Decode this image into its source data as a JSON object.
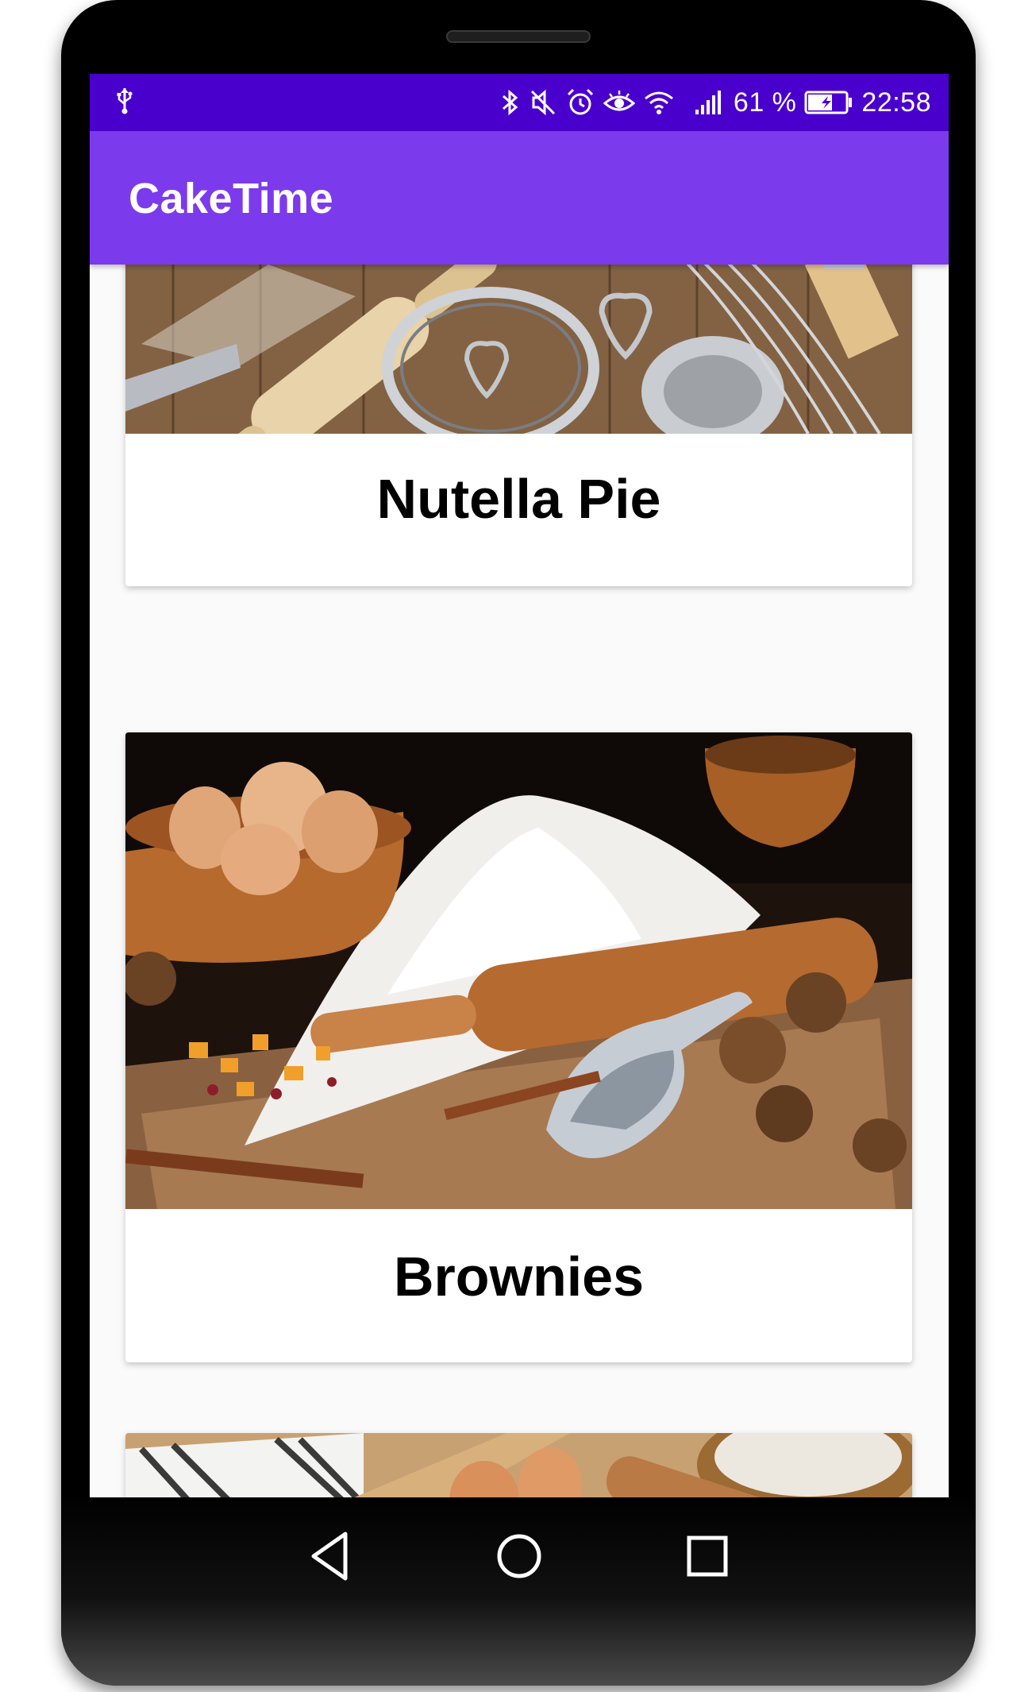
{
  "status_bar": {
    "battery_percent": "61 %",
    "time": "22:58",
    "icons": [
      "usb-icon",
      "bluetooth-icon",
      "mute-icon",
      "alarm-icon",
      "eye-icon",
      "wifi-icon",
      "signal-icon",
      "battery-charging-icon"
    ]
  },
  "app_bar": {
    "title": "CakeTime"
  },
  "cards": [
    {
      "title": "Nutella Pie",
      "image": "baking tools on wooden table"
    },
    {
      "title": "Brownies",
      "image": "eggs, flour, rolling pin and nuts"
    },
    {
      "title": "",
      "image": "eggs, flour sieve and rolling pin"
    }
  ],
  "nav_bar": {
    "icons": [
      "back-icon",
      "home-icon",
      "recents-icon"
    ]
  },
  "colors": {
    "status_bar": "#4a00cc",
    "app_bar": "#7c3aed",
    "list_background": "#fafafa"
  }
}
